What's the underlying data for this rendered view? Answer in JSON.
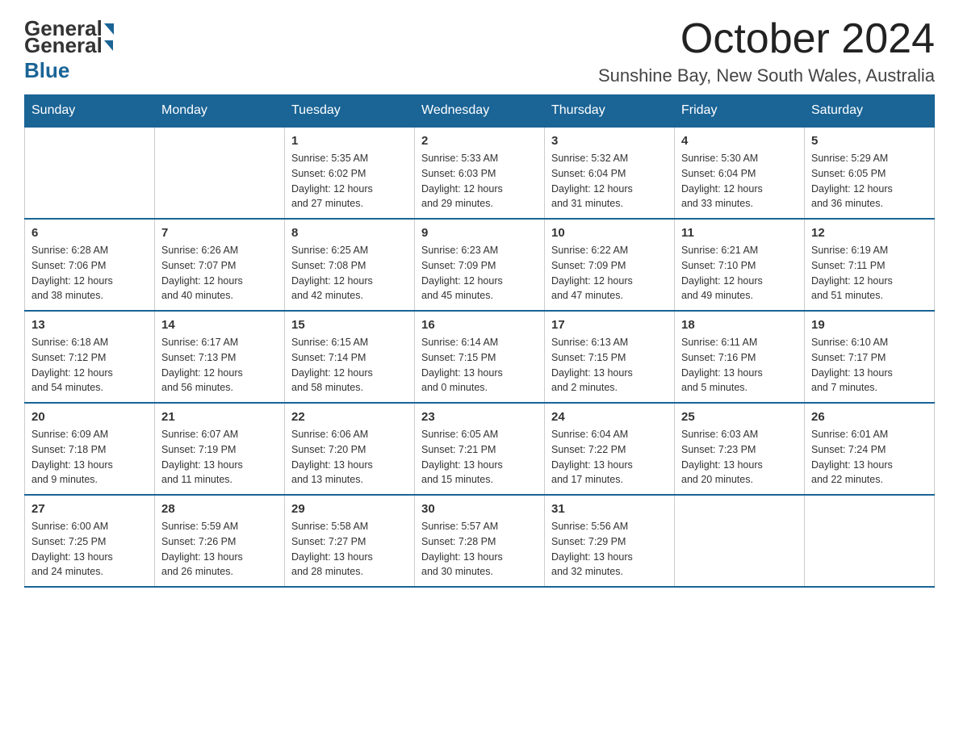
{
  "header": {
    "logo": {
      "general": "General",
      "blue": "Blue"
    },
    "title": "October 2024",
    "location": "Sunshine Bay, New South Wales, Australia"
  },
  "weekdays": [
    "Sunday",
    "Monday",
    "Tuesday",
    "Wednesday",
    "Thursday",
    "Friday",
    "Saturday"
  ],
  "weeks": [
    [
      {
        "day": "",
        "info": ""
      },
      {
        "day": "",
        "info": ""
      },
      {
        "day": "1",
        "info": "Sunrise: 5:35 AM\nSunset: 6:02 PM\nDaylight: 12 hours\nand 27 minutes."
      },
      {
        "day": "2",
        "info": "Sunrise: 5:33 AM\nSunset: 6:03 PM\nDaylight: 12 hours\nand 29 minutes."
      },
      {
        "day": "3",
        "info": "Sunrise: 5:32 AM\nSunset: 6:04 PM\nDaylight: 12 hours\nand 31 minutes."
      },
      {
        "day": "4",
        "info": "Sunrise: 5:30 AM\nSunset: 6:04 PM\nDaylight: 12 hours\nand 33 minutes."
      },
      {
        "day": "5",
        "info": "Sunrise: 5:29 AM\nSunset: 6:05 PM\nDaylight: 12 hours\nand 36 minutes."
      }
    ],
    [
      {
        "day": "6",
        "info": "Sunrise: 6:28 AM\nSunset: 7:06 PM\nDaylight: 12 hours\nand 38 minutes."
      },
      {
        "day": "7",
        "info": "Sunrise: 6:26 AM\nSunset: 7:07 PM\nDaylight: 12 hours\nand 40 minutes."
      },
      {
        "day": "8",
        "info": "Sunrise: 6:25 AM\nSunset: 7:08 PM\nDaylight: 12 hours\nand 42 minutes."
      },
      {
        "day": "9",
        "info": "Sunrise: 6:23 AM\nSunset: 7:09 PM\nDaylight: 12 hours\nand 45 minutes."
      },
      {
        "day": "10",
        "info": "Sunrise: 6:22 AM\nSunset: 7:09 PM\nDaylight: 12 hours\nand 47 minutes."
      },
      {
        "day": "11",
        "info": "Sunrise: 6:21 AM\nSunset: 7:10 PM\nDaylight: 12 hours\nand 49 minutes."
      },
      {
        "day": "12",
        "info": "Sunrise: 6:19 AM\nSunset: 7:11 PM\nDaylight: 12 hours\nand 51 minutes."
      }
    ],
    [
      {
        "day": "13",
        "info": "Sunrise: 6:18 AM\nSunset: 7:12 PM\nDaylight: 12 hours\nand 54 minutes."
      },
      {
        "day": "14",
        "info": "Sunrise: 6:17 AM\nSunset: 7:13 PM\nDaylight: 12 hours\nand 56 minutes."
      },
      {
        "day": "15",
        "info": "Sunrise: 6:15 AM\nSunset: 7:14 PM\nDaylight: 12 hours\nand 58 minutes."
      },
      {
        "day": "16",
        "info": "Sunrise: 6:14 AM\nSunset: 7:15 PM\nDaylight: 13 hours\nand 0 minutes."
      },
      {
        "day": "17",
        "info": "Sunrise: 6:13 AM\nSunset: 7:15 PM\nDaylight: 13 hours\nand 2 minutes."
      },
      {
        "day": "18",
        "info": "Sunrise: 6:11 AM\nSunset: 7:16 PM\nDaylight: 13 hours\nand 5 minutes."
      },
      {
        "day": "19",
        "info": "Sunrise: 6:10 AM\nSunset: 7:17 PM\nDaylight: 13 hours\nand 7 minutes."
      }
    ],
    [
      {
        "day": "20",
        "info": "Sunrise: 6:09 AM\nSunset: 7:18 PM\nDaylight: 13 hours\nand 9 minutes."
      },
      {
        "day": "21",
        "info": "Sunrise: 6:07 AM\nSunset: 7:19 PM\nDaylight: 13 hours\nand 11 minutes."
      },
      {
        "day": "22",
        "info": "Sunrise: 6:06 AM\nSunset: 7:20 PM\nDaylight: 13 hours\nand 13 minutes."
      },
      {
        "day": "23",
        "info": "Sunrise: 6:05 AM\nSunset: 7:21 PM\nDaylight: 13 hours\nand 15 minutes."
      },
      {
        "day": "24",
        "info": "Sunrise: 6:04 AM\nSunset: 7:22 PM\nDaylight: 13 hours\nand 17 minutes."
      },
      {
        "day": "25",
        "info": "Sunrise: 6:03 AM\nSunset: 7:23 PM\nDaylight: 13 hours\nand 20 minutes."
      },
      {
        "day": "26",
        "info": "Sunrise: 6:01 AM\nSunset: 7:24 PM\nDaylight: 13 hours\nand 22 minutes."
      }
    ],
    [
      {
        "day": "27",
        "info": "Sunrise: 6:00 AM\nSunset: 7:25 PM\nDaylight: 13 hours\nand 24 minutes."
      },
      {
        "day": "28",
        "info": "Sunrise: 5:59 AM\nSunset: 7:26 PM\nDaylight: 13 hours\nand 26 minutes."
      },
      {
        "day": "29",
        "info": "Sunrise: 5:58 AM\nSunset: 7:27 PM\nDaylight: 13 hours\nand 28 minutes."
      },
      {
        "day": "30",
        "info": "Sunrise: 5:57 AM\nSunset: 7:28 PM\nDaylight: 13 hours\nand 30 minutes."
      },
      {
        "day": "31",
        "info": "Sunrise: 5:56 AM\nSunset: 7:29 PM\nDaylight: 13 hours\nand 32 minutes."
      },
      {
        "day": "",
        "info": ""
      },
      {
        "day": "",
        "info": ""
      }
    ]
  ]
}
